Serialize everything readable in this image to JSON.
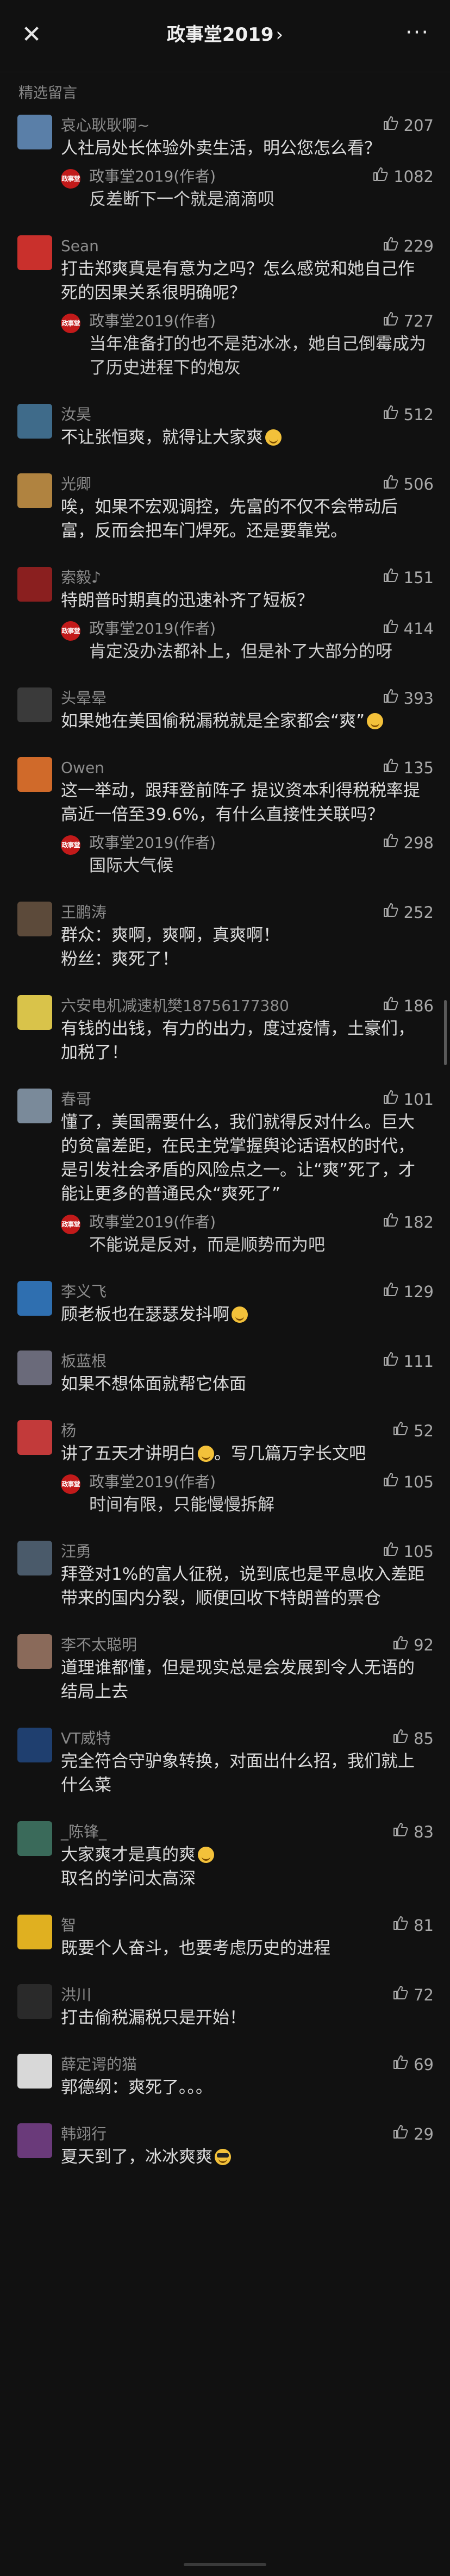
{
  "header": {
    "title": "政事堂2019",
    "title_chevron": "›",
    "close_icon": "✕",
    "more_icon": "···"
  },
  "section_label": "精选留言",
  "reply_badge_text": "政事堂",
  "accent_color": "#c21a1a",
  "comments": [
    {
      "author": "哀心耿耿啊~",
      "likes": "207",
      "text": "人社局处长体验外卖生活，明公您怎么看？",
      "avatar_color": "#5a7fa8",
      "reply": {
        "author": "政事堂2019(作者)",
        "likes": "1082",
        "text": "反差断下一个就是滴滴呗"
      }
    },
    {
      "author": "Sean",
      "likes": "229",
      "text": "打击郑爽真是有意为之吗？怎么感觉和她自己作死的因果关系很明确呢？",
      "avatar_color": "#c9302c",
      "reply": {
        "author": "政事堂2019(作者)",
        "likes": "727",
        "text": "当年准备打的也不是范冰冰，她自己倒霉成为了历史进程下的炮灰"
      }
    },
    {
      "author": "汝昊",
      "likes": "512",
      "text": "不让张恒爽，就得让大家爽",
      "emoji": true,
      "avatar_color": "#3f6b8a"
    },
    {
      "author": "光卿",
      "likes": "506",
      "text": "唉，如果不宏观调控，先富的不仅不会带动后富，反而会把车门焊死。还是要靠党。",
      "avatar_color": "#b08340"
    },
    {
      "author": "索毅♪",
      "likes": "151",
      "text": "特朗普时期真的迅速补齐了短板？",
      "avatar_color": "#8a1f1f",
      "reply": {
        "author": "政事堂2019(作者)",
        "likes": "414",
        "text": "肯定没办法都补上，但是补了大部分的呀"
      }
    },
    {
      "author": "头晕晕",
      "likes": "393",
      "text": "如果她在美国偷税漏税就是全家都会“爽”",
      "emoji": true,
      "avatar_color": "#3a3a3a"
    },
    {
      "author": "Owen",
      "likes": "135",
      "text": "这一举动，跟拜登前阵子 提议资本利得税税率提高近一倍至39.6%，有什么直接性关联吗？",
      "avatar_color": "#d06a2a",
      "reply": {
        "author": "政事堂2019(作者)",
        "likes": "298",
        "text": "国际大气候"
      }
    },
    {
      "author": "王鹏涛",
      "likes": "252",
      "text": "群众：爽啊，爽啊，真爽啊！\n粉丝：爽死了！",
      "avatar_color": "#5c4a3a"
    },
    {
      "author": "六安电机减速机樊18756177380",
      "likes": "186",
      "text": "有钱的出钱，有力的出力，度过疫情，土豪们，加税了！",
      "avatar_color": "#d9c34a"
    },
    {
      "author": "春哥",
      "likes": "101",
      "text": "懂了，美国需要什么，我们就得反对什么。巨大的贫富差距，在民主党掌握舆论话语权的时代，是引发社会矛盾的风险点之一。让“爽”死了，才能让更多的普通民众“爽死了”",
      "avatar_color": "#7a8a9a",
      "reply": {
        "author": "政事堂2019(作者)",
        "likes": "182",
        "text": "不能说是反对，而是顺势而为吧"
      }
    },
    {
      "author": "李义飞",
      "likes": "129",
      "text": "顾老板也在瑟瑟发抖啊",
      "emoji": true,
      "avatar_color": "#2f6fb0"
    },
    {
      "author": "板蓝根",
      "likes": "111",
      "text": "如果不想体面就帮它体面",
      "avatar_color": "#6a6a7a"
    },
    {
      "author": "杨",
      "likes": "52",
      "text": "讲了五天才讲明白",
      "emoji_mid": true,
      "text_after": "。写几篇万字长文吧",
      "avatar_color": "#c23a3a",
      "reply": {
        "author": "政事堂2019(作者)",
        "likes": "105",
        "text": "时间有限，只能慢慢拆解"
      }
    },
    {
      "author": "汪勇",
      "likes": "105",
      "text": "拜登对1%的富人征税，说到底也是平息收入差距带来的国内分裂，顺便回收下特朗普的票仓",
      "avatar_color": "#4a5a6a"
    },
    {
      "author": "李不太聪明",
      "likes": "92",
      "text": "道理谁都懂，但是现实总是会发展到令人无语的结局上去",
      "avatar_color": "#8a6a5a"
    },
    {
      "author": "VT威特",
      "likes": "85",
      "text": "完全符合守驴象转换，对面出什么招，我们就上什么菜",
      "avatar_color": "#1f3f6f"
    },
    {
      "author": "_陈锋_",
      "likes": "83",
      "text": "大家爽才是真的爽",
      "emoji": true,
      "text_line2": "取名的学问太高深",
      "avatar_color": "#3a6a5a"
    },
    {
      "author": "智",
      "likes": "81",
      "text": "既要个人奋斗，也要考虑历史的进程",
      "avatar_color": "#e0b020"
    },
    {
      "author": "洪川",
      "likes": "72",
      "text": "打击偷税漏税只是开始！",
      "avatar_color": "#2a2a2a"
    },
    {
      "author": "薛定谔的猫",
      "likes": "69",
      "text": "郭德纲：爽死了。。。",
      "avatar_color": "#d8d8d8"
    },
    {
      "author": "韩翊行",
      "likes": "29",
      "text": "夏天到了，冰冰爽爽",
      "emoji_sunglasses": true,
      "avatar_color": "#6a3a7a"
    }
  ]
}
